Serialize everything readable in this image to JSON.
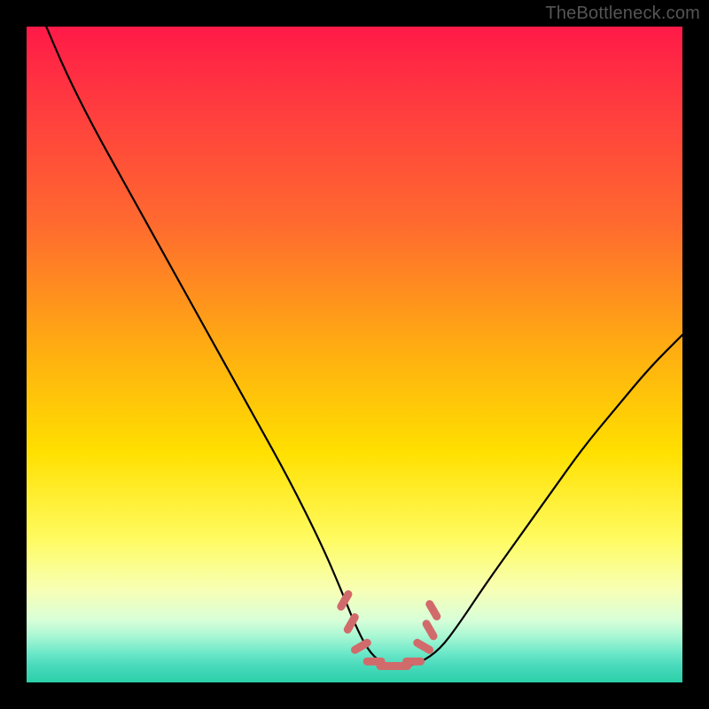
{
  "watermark": "TheBottleneck.com",
  "colors": {
    "frame": "#000000",
    "curve": "#000000",
    "marker": "#d16b6b",
    "gradient_stops": [
      {
        "offset": 0.0,
        "color": "#ff1a48"
      },
      {
        "offset": 0.12,
        "color": "#ff3b3f"
      },
      {
        "offset": 0.3,
        "color": "#ff6a2f"
      },
      {
        "offset": 0.5,
        "color": "#ffb010"
      },
      {
        "offset": 0.65,
        "color": "#ffe000"
      },
      {
        "offset": 0.78,
        "color": "#fffb60"
      },
      {
        "offset": 0.86,
        "color": "#f7ffb6"
      },
      {
        "offset": 0.905,
        "color": "#d8ffd8"
      },
      {
        "offset": 0.93,
        "color": "#a8f7d4"
      },
      {
        "offset": 0.955,
        "color": "#6ce8c8"
      },
      {
        "offset": 0.975,
        "color": "#48d9bb"
      },
      {
        "offset": 1.0,
        "color": "#2bd0a8"
      }
    ]
  },
  "chart_data": {
    "type": "line",
    "title": "",
    "xlabel": "",
    "ylabel": "",
    "xlim": [
      0,
      100
    ],
    "ylim": [
      0,
      100
    ],
    "grid": false,
    "legend": false,
    "series": [
      {
        "name": "bottleneck-curve",
        "x": [
          3,
          6,
          10,
          15,
          20,
          25,
          30,
          35,
          40,
          45,
          48,
          50,
          52,
          54,
          56,
          58,
          60,
          63,
          66,
          70,
          75,
          80,
          85,
          90,
          95,
          100
        ],
        "y": [
          100,
          93,
          85,
          76,
          67,
          58,
          49,
          40,
          31,
          21,
          14,
          9,
          5,
          3,
          2.5,
          2.5,
          3,
          5,
          9,
          15,
          22,
          29,
          36,
          42,
          48,
          53
        ]
      }
    ],
    "markers": {
      "name": "fit-region",
      "x": [
        48.5,
        49.5,
        51.0,
        53.0,
        55.0,
        57.0,
        59.0,
        60.5,
        61.5,
        62.0
      ],
      "y": [
        12.5,
        9.0,
        5.5,
        3.2,
        2.5,
        2.5,
        3.2,
        5.5,
        8.0,
        11.0
      ]
    }
  }
}
